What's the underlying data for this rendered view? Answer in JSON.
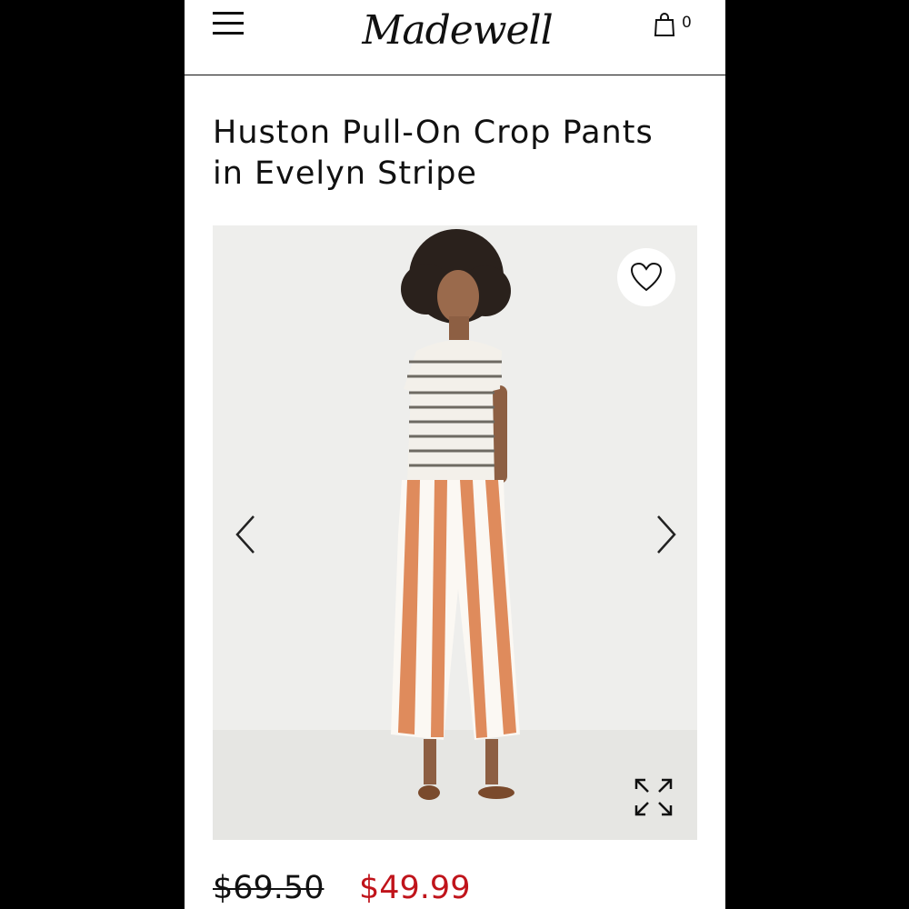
{
  "header": {
    "logo": "Madewell",
    "cart_count": "0"
  },
  "product": {
    "title_line1": "Huston Pull-On Crop Pants",
    "title_line2": "in Evelyn Stripe",
    "price_original": "$69.50",
    "price_sale": "$49.99",
    "image_alt": "Model wearing striped cropped pull-on pants with a striped tee and sandals"
  },
  "icons": {
    "menu": "menu-icon",
    "cart": "shopping-bag-icon",
    "favorite": "heart-icon",
    "prev": "chevron-left-icon",
    "next": "chevron-right-icon",
    "expand": "expand-icon"
  },
  "colors": {
    "sale_price": "#c0141b",
    "text": "#111111",
    "gallery_bg": "#eeeeec"
  }
}
